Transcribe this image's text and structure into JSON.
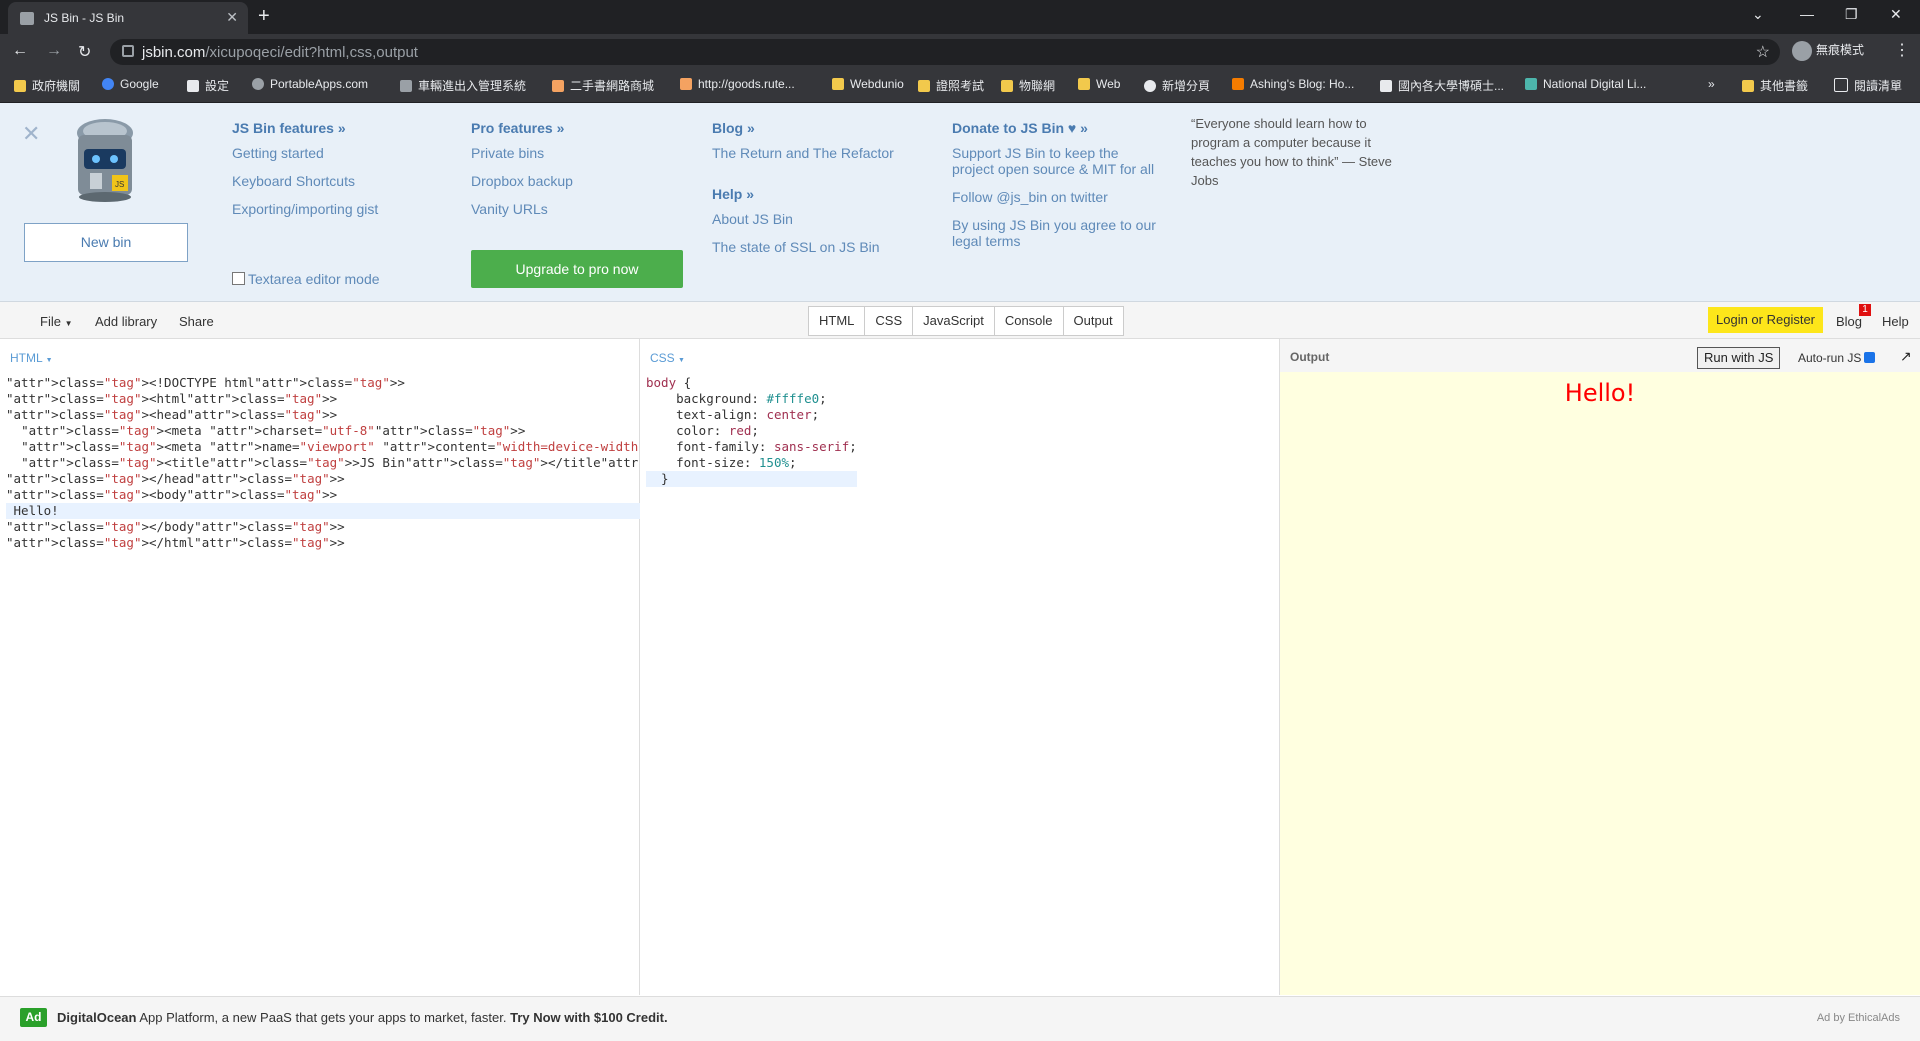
{
  "browser": {
    "tab_title": "JS Bin - JS Bin",
    "url_host": "jsbin.com",
    "url_path": "/xicupoqeci/edit?html,css,output",
    "profile_label": "無痕模式",
    "bookmarks": [
      {
        "label": "政府機關",
        "icon": "folder-icon",
        "color": "#f2c94c"
      },
      {
        "label": "Google",
        "icon": "google-icon",
        "color": "#4285f4"
      },
      {
        "label": "設定",
        "icon": "gear-icon",
        "color": "#e8eaed"
      },
      {
        "label": "PortableApps.com",
        "icon": "globe-icon",
        "color": "#9aa0a6"
      },
      {
        "label": "車輛進出入管理系統",
        "icon": "car-icon",
        "color": "#9aa0a6"
      },
      {
        "label": "二手書網路商城",
        "icon": "book-icon",
        "color": "#f4a261"
      },
      {
        "label": "http://goods.rute...",
        "icon": "diamond-icon",
        "color": "#f4a261"
      },
      {
        "label": "Webdunio",
        "icon": "folder-icon",
        "color": "#f2c94c"
      },
      {
        "label": "證照考試",
        "icon": "folder-icon",
        "color": "#f2c94c"
      },
      {
        "label": "物聯網",
        "icon": "folder-icon",
        "color": "#f2c94c"
      },
      {
        "label": "Web",
        "icon": "folder-icon",
        "color": "#f2c94c"
      },
      {
        "label": "新增分頁",
        "icon": "globe-icon",
        "color": "#e8eaed"
      },
      {
        "label": "Ashing's Blog: Ho...",
        "icon": "blogger-icon",
        "color": "#f57c00"
      },
      {
        "label": "國內各大學博碩士...",
        "icon": "doc-icon",
        "color": "#e8eaed"
      },
      {
        "label": "National Digital Li...",
        "icon": "library-icon",
        "color": "#4db6ac"
      }
    ],
    "more_bookmarks": "»",
    "other_bookmarks": "其他書籤",
    "reading_list": "閱讀清單"
  },
  "jsbin_panel": {
    "new_bin": "New bin",
    "features": {
      "title": "JS Bin features »",
      "links": [
        "Getting started",
        "Keyboard Shortcuts",
        "Exporting/importing gist"
      ]
    },
    "textarea_mode": "Textarea editor mode",
    "pro": {
      "title": "Pro features »",
      "links": [
        "Private bins",
        "Dropbox backup",
        "Vanity URLs"
      ],
      "upgrade": "Upgrade to pro now"
    },
    "blog": {
      "title": "Blog »",
      "links": [
        "The Return and The Refactor"
      ]
    },
    "help": {
      "title": "Help »",
      "links": [
        "About JS Bin",
        "The state of SSL on JS Bin"
      ]
    },
    "donate": {
      "title": "Donate to JS Bin ♥ »",
      "links": [
        "Support JS Bin to keep the project open source & MIT for all",
        "Follow @js_bin on twitter",
        "By using JS Bin you agree to our legal terms"
      ]
    },
    "quote": "“Everyone should learn how to program a computer because it teaches you how to think” — Steve Jobs"
  },
  "toolbar": {
    "file": "File",
    "add_library": "Add library",
    "share": "Share",
    "panel_tabs": [
      "HTML",
      "CSS",
      "JavaScript",
      "Console",
      "Output"
    ],
    "login": "Login or Register",
    "blog": "Blog",
    "blog_badge": "1",
    "help": "Help"
  },
  "html_panel": {
    "label": "HTML",
    "code": [
      "<!DOCTYPE html>",
      "<html>",
      "<head>",
      "  <meta charset=\"utf-8\">",
      "  <meta name=\"viewport\" content=\"width=device-width\">",
      "  <title>JS Bin</title>",
      "</head>",
      "<body>",
      " Hello!",
      "</body>",
      "</html>"
    ]
  },
  "css_panel": {
    "label": "CSS",
    "code": [
      "body {",
      "    background: #ffffe0;",
      "    text-align: center;",
      "    color: red;",
      "    font-family: sans-serif;",
      "    font-size: 150%;",
      "  }"
    ]
  },
  "output_panel": {
    "label": "Output",
    "run_with_js": "Run with JS",
    "auto_run": "Auto-run JS",
    "rendered_text": "Hello!",
    "background": "#ffffe0",
    "text_color": "#ff0000"
  },
  "ad": {
    "tag": "Ad",
    "brand": "DigitalOcean",
    "text": "App Platform, a new PaaS that gets your apps to market, faster.",
    "cta": "Try Now with $100 Credit.",
    "by": "Ad by EthicalAds"
  }
}
